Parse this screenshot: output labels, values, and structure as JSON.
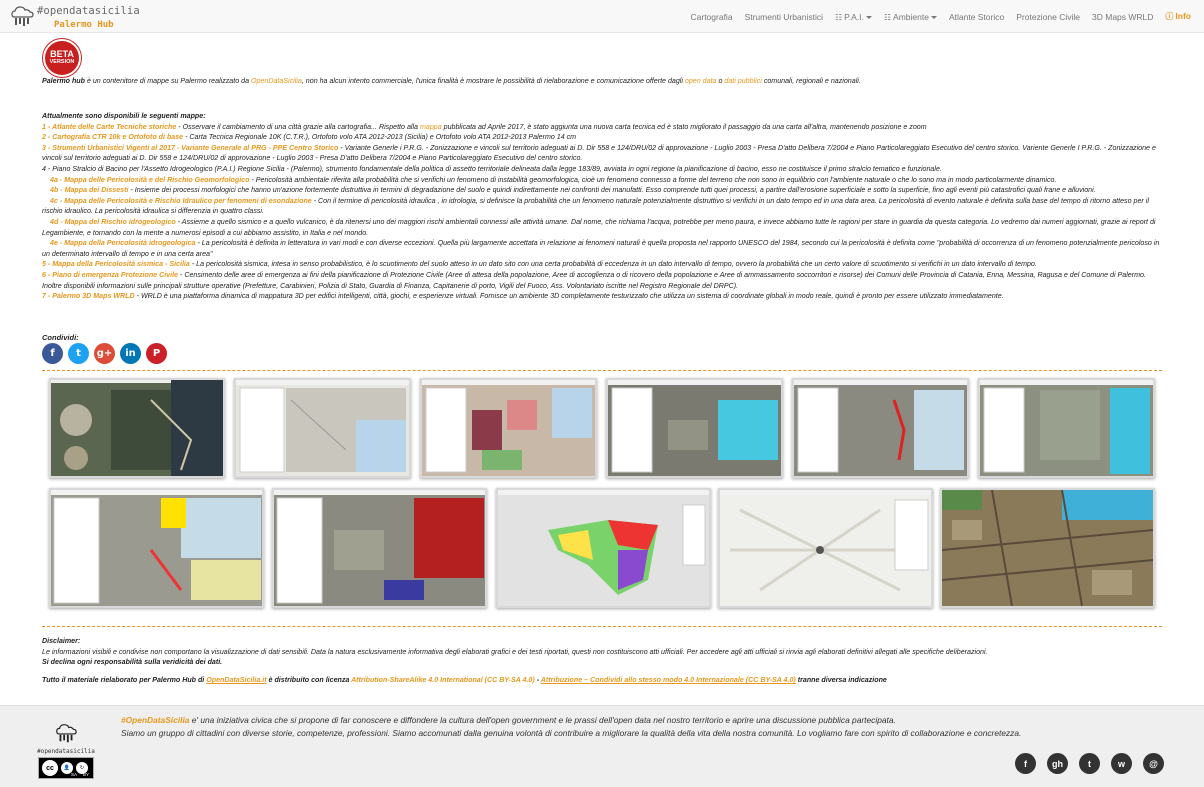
{
  "brand": {
    "title": "#opendatasicilia",
    "subtitle": "Palermo Hub"
  },
  "nav": {
    "items": [
      {
        "label": "Cartografia"
      },
      {
        "label": "Strumenti Urbanistici"
      },
      {
        "label": "P.A.I."
      },
      {
        "label": "Ambiente"
      },
      {
        "label": "Atlante Storico"
      },
      {
        "label": "Protezione Civile"
      },
      {
        "label": "3D Maps WRLD"
      },
      {
        "label": "Info"
      }
    ]
  },
  "beta": {
    "line1": "BETA",
    "line2": "VERSION"
  },
  "intro": {
    "lead": "Palermo hub",
    "text1": " è un contenitore di mappe su Palermo realizzato da ",
    "link1": "OpenDataSicilia",
    "text2": ", non ha alcun intento commerciale, l'unica finalità è mostrare le possibilità di rielaborazione e comunicazione offerte dagli ",
    "link2": "open data",
    "text3": " o ",
    "link3": "dati pubblici",
    "text4": " comunali, regionali e nazionali."
  },
  "maps_heading": "Attualmente sono disponibili le seguenti mappe:",
  "maps": [
    {
      "title": "1 - Atlante delle Carte Tecniche storiche",
      "desc": " - Osservare il cambiamento di una città grazie alla cartografia... Rispetto alla ",
      "link": "mappa",
      "desc2": " pubblicata ad Aprile 2017, è stato aggiunta una nuova carta tecnica ed è stato migliorato il passaggio da una carta all'altra, mantenendo posizione e zoom"
    },
    {
      "title": "2 - Cartografia CTR 10k e Ortofoto di base",
      "desc": " - Carta Tecnica Regionale 10K (C.T.R.), Ortofoto volo ATA 2012-2013 (Sicilia) e Ortofoto volo ATA 2012-2013 Palermo 14 cm",
      "link": "",
      "desc2": ""
    },
    {
      "title": "3 - Strumenti Urbanistici Vigenti al 2017 - Variante Generale al PRG - PPE Centro Storico",
      "desc": " - Variante Generle i P.R.G. - Zonizzazione e vincoli sul territorio adeguati ai D. Dir 558 e 124/DRU/02 di approvazione - Luglio 2003 - Presa D'atto Delibera 7/2004 e Piano Particolareggiato Esecutivo del centro storico. Variente Generle I P.R.G. - Zonizzazione e vincoli sul territorio adeguati ai D. Dir 558 e 124/DRU/02 di approvazione - Luglio 2003 - Presa D'atto Delibera 7/2004 e Piano Particolareggiato Esecutivo del centro storico.",
      "link": "",
      "desc2": ""
    },
    {
      "title": "",
      "desc": "4 - Piano Stralcio di Bacino per l'Assetto Idrogeologico (P.A.I.) Regione Sicilia - (Palermo), strumento fondamentale della politica di assetto territoriale delineata dalla legge 183/89, avviata in ogni regione la pianificazione di bacino, esso ne costituisce il primo stralcio tematico e funzionale.",
      "link": "",
      "desc2": ""
    },
    {
      "title": "4a - Mappa delle Pericolosità e del Rischio Geomorfologico",
      "desc": " - Pericolosità ambientale riferita alla probabilità che si verifichi un fenomeno di instabilità geomorfologica, cioè un fenomeno connesso a forme del terreno che non sono in equilibrio con l'ambiente naturale o che lo sono ma in modo particolarmente dinamico.",
      "link": "",
      "desc2": ""
    },
    {
      "title": "4b - Mappa dei Dissesti",
      "desc": " - Insieme dei processi morfologici che hanno un'azione fortemente distruttiva in termini di degradazione del suolo e quindi indirettamente nei confronti dei manufatti. Esso comprende tutti quei processi, a partire dall'erosione superficiale e sotto la superficie, fino agli eventi più catastrofici quali frane e alluvioni.",
      "link": "",
      "desc2": ""
    },
    {
      "title": "4c - Mappa delle Pericolosità e Rischio Idraulico per fenomeni di esondazione",
      "desc": " - Con il termine di pericolosità idraulica , in idrologia, si definisce la probabilità che un fenomeno naturale potenzialmente distruttivo si verifichi in un dato tempo ed in una data area. La pericolosità di evento naturale è definita sulla base del tempo di ritorno atteso per il rischio idraulico. La pericolosità idraulica si differenzia in quattro classi.",
      "link": "",
      "desc2": ""
    },
    {
      "title": "4d - Mappa del Rischio idrogeologico",
      "desc": " - Assieme a quello sismico e a quello vulcanico, è da ritenersi uno dei maggiori rischi ambientali connessi alle attività umane. Dal nome, che richiama l'acqua, potrebbe per meno paura, e invece abbiamo tutte le ragioni per stare in guardia da questa categoria. Lo vedremo dai numeri aggiornati, grazie ai report di Legambiente, e tornando con la mente a numerosi episodi a cui abbiamo assistito, in Italia e nel mondo.",
      "link": "",
      "desc2": ""
    },
    {
      "title": "4e - Mappa della Pericolosità idrogeologica",
      "desc": " - La pericolosità è definita in letteratura in vari modi e con diverse eccezioni. Quella più largamente accettata in relazione ai fenomeni naturali è quella proposta nel rapporto UNESCO del 1984, secondo cui la pericolosità è definita come \"probabilità di occorrenza di un fenomeno potenzialmente pericoloso in un determinato intervallo di tempo e in una certa area\"",
      "link": "",
      "desc2": ""
    },
    {
      "title": "5 - Mappa della Pericolosità sismica - Sicilia",
      "desc": " - La pericolosità sismica, intesa in senso probabilistico, è lo scuotimento del suolo atteso in un dato sito con una certa probabilità di eccedenza in un dato intervallo di tempo, ovvero la probabilità che un certo valore di scuotimento si verifichi in un dato intervallo di tempo.",
      "link": "",
      "desc2": ""
    },
    {
      "title": "6 - Piano di emergenza Protezione Civile",
      "desc": " - Censimento delle aree di emergenza ai fini della pianificazione di Protezione Civile (Aree di attesa della popolazione, Aree di accoglienza o di ricovero della popolazione e Aree di ammassamento soccorritori e risorse) dei Comuni delle Provincia di Catania, Enna, Messina, Ragusa e del Comune di Palermo. Inoltre disponibili informazioni sulle principali strutture operative (Prefetture, Carabinieri, Polizia di Stato, Guardia di Finanza, Capitanerie di porto, Vigili del Fuoco, Ass. Volontariato iscritte nel Registro Regionale del DRPC).",
      "link": "",
      "desc2": ""
    },
    {
      "title": "7 - Palermo 3D Maps WRLD",
      "desc": " - WRLD è una piattaforma dinamica di mappatura 3D per edifici intelligenti, città, giochi, e esperienze virtuali. Fornisce un ambiente 3D completamente testurizzato che utilizza un sistema di coordinate globali in modo reale, quindi è pronto per essere utilizzato immediatamente.",
      "link": "",
      "desc2": ""
    }
  ],
  "share": {
    "label": "Condividi:",
    "buttons": [
      {
        "icon": "facebook-icon",
        "glyph": "f",
        "color": "#3b5998"
      },
      {
        "icon": "twitter-icon",
        "glyph": "t",
        "color": "#1da1f2"
      },
      {
        "icon": "googleplus-icon",
        "glyph": "g+",
        "color": "#dd4b39"
      },
      {
        "icon": "linkedin-icon",
        "glyph": "in",
        "color": "#0077b5"
      },
      {
        "icon": "pinterest-icon",
        "glyph": "P",
        "color": "#cb2027"
      }
    ]
  },
  "disclaimer": {
    "title": "Disclaimer:",
    "text": "Le informazioni visibili e condivise non comportano la visualizzazione di dati sensibili. Data la natura esclusivamente informativa degli elaborati grafici e dei testi riportati, questi non costituiscono atti ufficiali. Per accedere agli atti ufficiali si rinvia agli elaborati definitivi allegati alle specifiche deliberazioni.",
    "bold": "Si declina ogni responsabilità sulla veridicità dei dati."
  },
  "license": {
    "t1": "Tutto il materiale rielaborato per Palermo Hub di ",
    "l1": "OpenDataSicilia.it",
    "t2": " è distribuito con licenza ",
    "l2": "Attribution-ShareAlike 4.0 International (CC BY-SA 4.0)",
    "t3": " - ",
    "l3": "Attribuzione – Condividi allo stesso modo 4.0 Internazionale (CC BY-SA 4.0)",
    "t4": " tranne diversa indicazione"
  },
  "footer": {
    "logo_name": "#opendatasicilia",
    "cc": "cc",
    "cc_by": "BY",
    "cc_sa": "SA",
    "lead": "#OpenDataSicilia",
    "text1": " e' una iniziativa civica che si propone di far conoscere e diffondere la cultura dell'open government e le prassi dell'open data nel nostro territorio e aprire una discussione pubblica partecipata.",
    "text2": "Siamo un gruppo di cittadini con diverse storie, competenze, professioni. Siamo accomunati dalla genuina volontà di contribuire a migliorare la qualità della vita della nostra comunità. Lo vogliamo fare con spirito di collaborazione e concretezza.",
    "social": [
      {
        "icon": "facebook-icon",
        "glyph": "f"
      },
      {
        "icon": "github-icon",
        "glyph": "gh"
      },
      {
        "icon": "twitter-icon",
        "glyph": "t"
      },
      {
        "icon": "web-icon",
        "glyph": "w"
      },
      {
        "icon": "email-icon",
        "glyph": "@"
      }
    ]
  },
  "colors": {
    "accent": "#e6981e",
    "beta": "#c8201e",
    "nav_bg": "#f8f8f8",
    "footer_bg": "#efefef"
  }
}
